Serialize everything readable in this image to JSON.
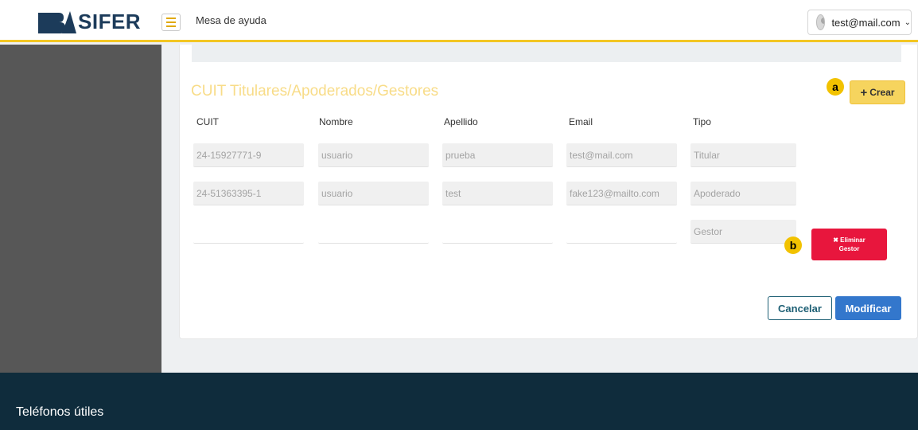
{
  "header": {
    "logo_text": "SIFER",
    "title": "Mesa de ayuda",
    "user_email": "test@mail.com",
    "accent_color": "#f3c623"
  },
  "section": {
    "title": "CUIT Titulares/Apoderados/Gestores",
    "create_label": "Crear",
    "create_icon": "plus-icon"
  },
  "annotations": {
    "a": "a",
    "b": "b"
  },
  "table": {
    "columns": [
      "CUIT",
      "Nombre",
      "Apellido",
      "Email",
      "Tipo"
    ],
    "rows": [
      {
        "cuit": "24-15927771-9",
        "nombre": "usuario",
        "apellido": "prueba",
        "email": "test@mail.com",
        "tipo": "Titular"
      },
      {
        "cuit": "24-51363395-1",
        "nombre": "usuario",
        "apellido": "test",
        "email": "fake123@mailto.com",
        "tipo": "Apoderado"
      },
      {
        "cuit": "",
        "nombre": "",
        "apellido": "",
        "email": "",
        "tipo": "Gestor"
      }
    ]
  },
  "actions": {
    "delete_line1": "Eliminar",
    "delete_line2": "Gestor",
    "delete_icon": "x-icon",
    "delete_color": "#e8163d",
    "cancel_label": "Cancelar",
    "modify_label": "Modificar",
    "modify_color": "#3377cc"
  },
  "footer": {
    "title": "Teléfonos útiles"
  }
}
